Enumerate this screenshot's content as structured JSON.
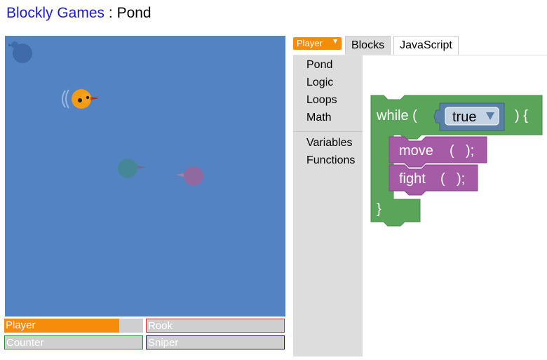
{
  "header": {
    "brand": "Blockly Games",
    "separator": " : ",
    "page": "Pond"
  },
  "arena": {
    "background": "#5383c3",
    "ducks": [
      {
        "name": "rook",
        "color": "#2a5fa8"
      },
      {
        "name": "player",
        "color": "#f59b10"
      },
      {
        "name": "counter",
        "color": "#3d8c84"
      },
      {
        "name": "sniper",
        "color": "#b9588c"
      }
    ]
  },
  "health": [
    {
      "label": "Player",
      "color": "#f58c0a",
      "level_percent": 83
    },
    {
      "label": "Rook",
      "color": "#c63636",
      "level_percent": 0
    },
    {
      "label": "Counter",
      "color": "#2f8c3e",
      "level_percent": 0
    },
    {
      "label": "Sniper",
      "color": "#1a1a40",
      "level_percent": 0
    }
  ],
  "editor": {
    "language_select": "Player",
    "tabs": {
      "blocks": "Blocks",
      "javascript": "JavaScript"
    },
    "toolbox": [
      "Pond",
      "Logic",
      "Loops",
      "Math",
      "Variables",
      "Functions"
    ],
    "code": {
      "while_kw": "while (",
      "while_end": ") {",
      "condition": "true",
      "move_kw": "move",
      "fight_kw": "fight",
      "paren_open": "(",
      "paren_close": ");",
      "close_brace": "}"
    }
  }
}
